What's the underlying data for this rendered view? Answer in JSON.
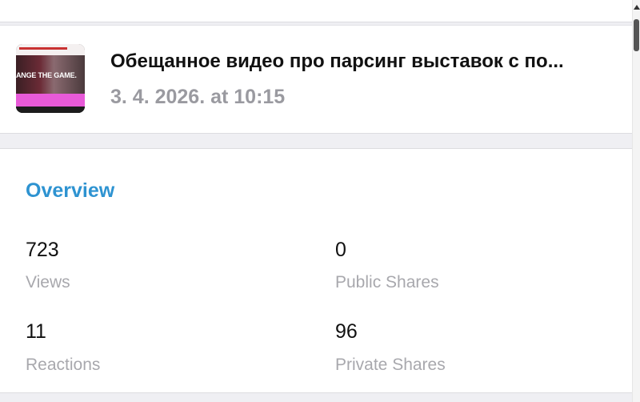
{
  "post": {
    "title": "Обещанное видео про парсинг выставок с по...",
    "date": "3. 4. 2026. at 10:15",
    "thumbnail_text": "ANGE THE GAME."
  },
  "overview": {
    "title": "Overview",
    "stats": [
      {
        "value": "723",
        "label": "Views"
      },
      {
        "value": "0",
        "label": "Public Shares"
      },
      {
        "value": "11",
        "label": "Reactions"
      },
      {
        "value": "96",
        "label": "Private Shares"
      }
    ]
  },
  "colors": {
    "accent": "#2e93d1",
    "muted_text": "#a8a8ad",
    "background": "#efeff3"
  }
}
